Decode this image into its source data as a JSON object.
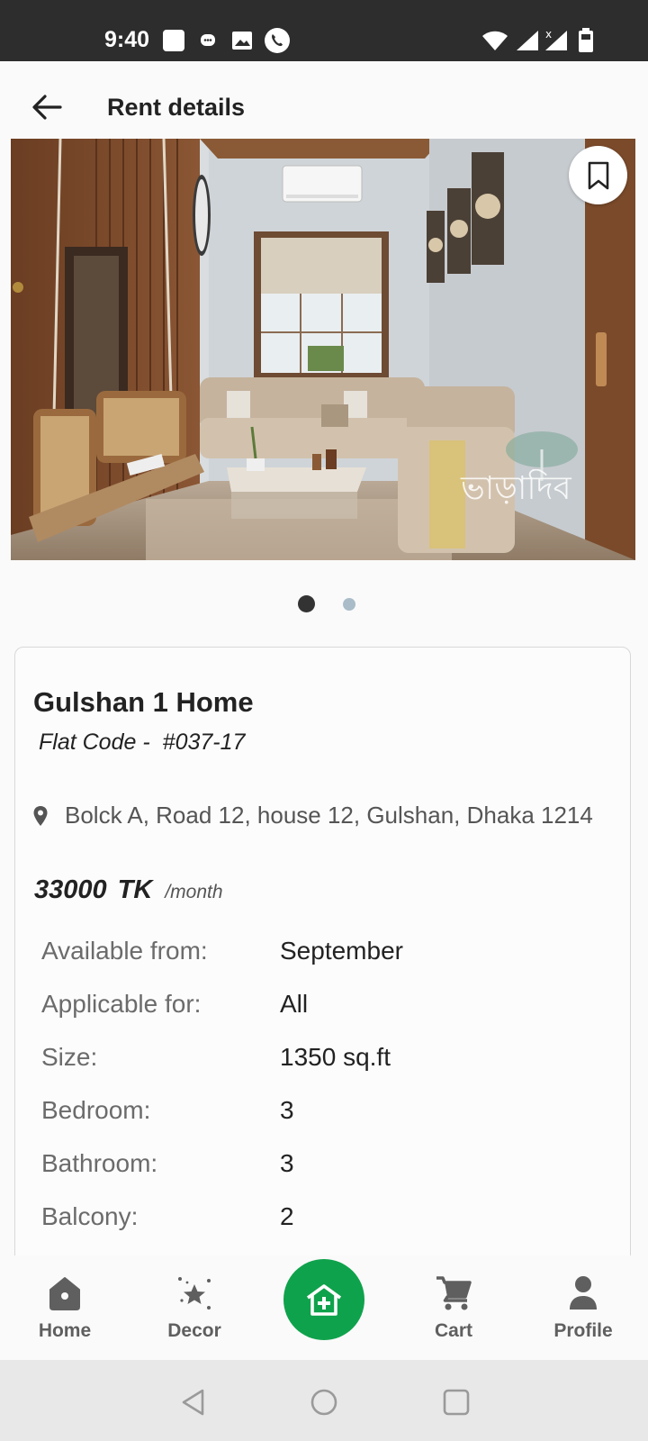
{
  "status_bar": {
    "time": "9:40",
    "left_icons": [
      "square-notification-icon",
      "chat-icon",
      "image-icon",
      "phone-icon"
    ],
    "right_icons": [
      "wifi-icon",
      "signal-icon",
      "signal-no-data-icon",
      "battery-icon"
    ]
  },
  "app_bar": {
    "title": "Rent details",
    "back_icon": "arrow-left-icon"
  },
  "carousel": {
    "image_alt": "Living room with beige sectional sofa and wooden swing",
    "watermark": "ভাড়াদিব",
    "slide_count": 2,
    "active_slide": 1,
    "bookmark_icon": "bookmark-icon"
  },
  "property": {
    "title": "Gulshan 1 Home",
    "flat_code_label": "Flat Code -",
    "flat_code_value": "#037-17",
    "address": "Bolck A, Road 12, house 12, Gulshan, Dhaka 1214",
    "price_amount": "33000",
    "price_currency": "TK",
    "price_period": "/month",
    "details": [
      {
        "label": "Available from:",
        "value": "September"
      },
      {
        "label": "Applicable for:",
        "value": "All"
      },
      {
        "label": "Size:",
        "value": "1350 sq.ft"
      },
      {
        "label": "Bedroom:",
        "value": "3"
      },
      {
        "label": "Bathroom:",
        "value": "3"
      },
      {
        "label": "Balcony:",
        "value": "2"
      }
    ]
  },
  "bottom_nav": {
    "items": [
      {
        "label": "Home",
        "icon": "home-icon"
      },
      {
        "label": "Decor",
        "icon": "decor-stars-icon"
      },
      {
        "label": "Cart",
        "icon": "cart-icon"
      },
      {
        "label": "Profile",
        "icon": "profile-icon"
      }
    ],
    "fab_icon": "add-home-icon"
  },
  "colors": {
    "accent_green": "#0fa24c",
    "status_bar": "#2d2d2d",
    "dot_active": "#333333",
    "dot_idle": "#a9bcc8"
  }
}
